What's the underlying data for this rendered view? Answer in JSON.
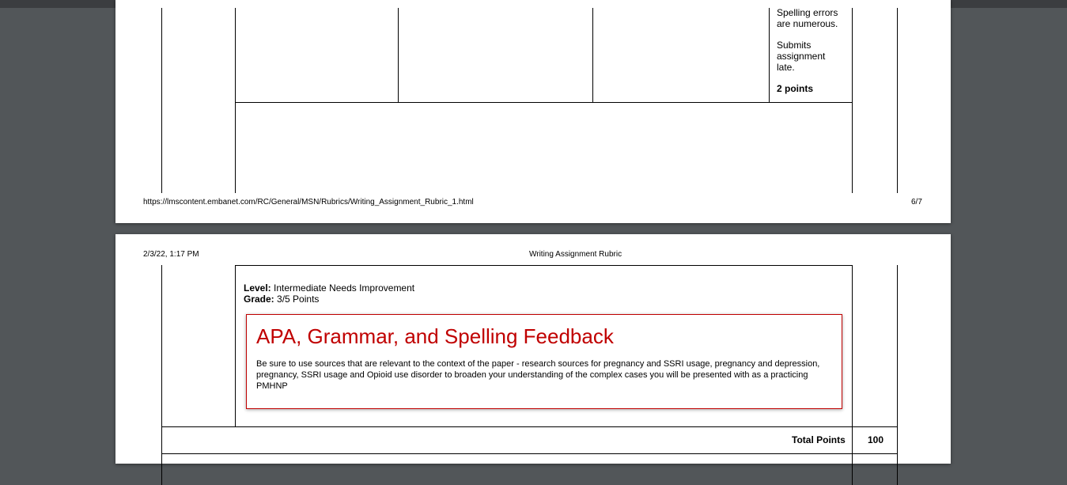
{
  "page1": {
    "criteria_lines": [
      "Spelling errors",
      "are numerous."
    ],
    "submission_lines": [
      "Submits",
      "assignment",
      "late."
    ],
    "points": "2 points",
    "footer_url": "https://lmscontent.embanet.com/RC/General/MSN/Rubrics/Writing_Assignment_Rubric_1.html",
    "page_number": "6/7"
  },
  "page2": {
    "header_date": "2/3/22, 1:17 PM",
    "header_title": "Writing Assignment Rubric",
    "level_label": "Level:",
    "level_value": "Intermediate Needs Improvement",
    "grade_label": "Grade:",
    "grade_value": "3/5 Points",
    "feedback": {
      "title": "APA, Grammar, and Spelling Feedback",
      "body": "Be sure to use sources that are relevant to the context of the paper - research sources for pregnancy and SSRI usage, pregnancy and depression, pregnancy, SSRI usage and Opioid use disorder to broaden your understanding of the complex cases you will be presented with as a practicing PMHNP"
    },
    "total_points_label": "Total Points",
    "total_points_value": "100"
  },
  "colors": {
    "viewer_background": "#525659",
    "feedback_accent": "#c00000"
  }
}
